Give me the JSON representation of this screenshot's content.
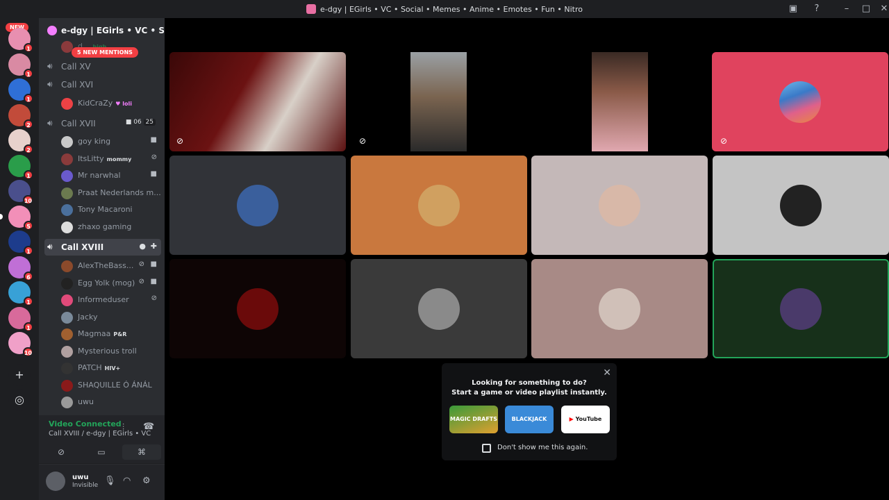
{
  "window": {
    "title": "e-dgy | EGirls • VC • Social • Memes • Anime • Emotes • Fun • Nitro",
    "controls": [
      "inbox-icon",
      "help-icon",
      "minimize-icon",
      "maximize-icon",
      "close-icon"
    ]
  },
  "server_rail": {
    "new_label": "NEW",
    "servers": [
      {
        "badge": "1",
        "color": "#e88fb0"
      },
      {
        "badge": "1",
        "color": "#d98aa3"
      },
      {
        "badge": "1",
        "color": "#2f6fd6"
      },
      {
        "badge": "2",
        "color": "#c24b3a"
      },
      {
        "badge": "2",
        "color": "#e7d1cc"
      },
      {
        "badge": "1",
        "color": "#2a9d4a"
      },
      {
        "badge": "10",
        "color": "#4a4f8c"
      },
      {
        "badge": "5",
        "color": "#f28fb8"
      },
      {
        "badge": "1",
        "color": "#1d3c8c"
      },
      {
        "badge": "6",
        "color": "#c06fd6"
      },
      {
        "badge": "1",
        "color": "#38a1d6"
      },
      {
        "badge": "1",
        "color": "#d86a9b"
      },
      {
        "badge": "10",
        "color": "#f0a0c8"
      }
    ],
    "add_icon": "plus-icon",
    "explore_icon": "compass-icon"
  },
  "guild": {
    "name": "e-dgy | EGirls • VC • S...",
    "mentions": "5 NEW MENTIONS",
    "partial_user_tag": "high"
  },
  "channels": {
    "call_xv": "Call XV",
    "call_xvi": "Call XVI",
    "call_xvi_users": [
      {
        "name": "KidCraZy",
        "tag": "loli",
        "avatar": "#ed4245"
      }
    ],
    "call_xvii": "Call XVII",
    "call_xvii_video": "06",
    "call_xvii_count": "25",
    "call_xvii_users": [
      {
        "name": "goy king",
        "tag": "",
        "avatar": "#c9c9c9",
        "status": "video-icon"
      },
      {
        "name": "ItsLitty",
        "tag": "mommy",
        "avatar": "#8a3b3b",
        "status": "mic-muted-icon"
      },
      {
        "name": "Mr narwhal",
        "tag": "",
        "avatar": "#6a5acd",
        "status": "video-icon"
      },
      {
        "name": "Praat Nederlands m...",
        "tag": "",
        "avatar": "#6b7a4f",
        "status": ""
      },
      {
        "name": "Tony Macaroni",
        "tag": "",
        "avatar": "#4a6f9c",
        "status": ""
      },
      {
        "name": "zhaxo gaming",
        "tag": "",
        "avatar": "#dddddd",
        "status": ""
      }
    ],
    "call_xviii": "Call XVIII",
    "call_xviii_users": [
      {
        "name": "AlexTheBass...",
        "tag": "",
        "avatar": "#8b4a2b",
        "status": "mic-muted-icon video-icon"
      },
      {
        "name": "Egg Yolk (mog)",
        "tag": "",
        "avatar": "#222222",
        "status": "mic-muted-icon video-icon"
      },
      {
        "name": "Informeduser",
        "tag": "",
        "avatar": "#e04a7a",
        "status": "mic-muted-icon"
      },
      {
        "name": "Jacky",
        "tag": "",
        "avatar": "#7a8a9a",
        "status": ""
      },
      {
        "name": "Magmaa",
        "tag": "P&R",
        "avatar": "#a06030",
        "status": ""
      },
      {
        "name": "Mysterious troll",
        "tag": "",
        "avatar": "#b0a0a0",
        "status": ""
      },
      {
        "name": "PATCH",
        "tag": "HIV+",
        "avatar": "#333333",
        "status": ""
      },
      {
        "name": "SHAQUILLE Ó ÁNÁL",
        "tag": "",
        "avatar": "#8a1a1a",
        "status": ""
      },
      {
        "name": "uwu",
        "tag": "",
        "avatar": "#9a9a9a",
        "status": ""
      }
    ]
  },
  "voice_panel": {
    "status": "Video Connected",
    "location": "Call XVIII / e-dgy | EGirls • VC • ..."
  },
  "user_panel": {
    "name": "uwu",
    "status": "Invisible"
  },
  "stage": {
    "tiles_row2": [
      {
        "bg": "#313338",
        "avatar": "#3a5f9c"
      },
      {
        "bg": "#c9783e",
        "avatar": "#d0a060"
      },
      {
        "bg": "#c4b8b8",
        "avatar": "#d8b8a8"
      },
      {
        "bg": "#c4c4c4",
        "avatar": "#222222"
      }
    ],
    "tiles_row3": [
      {
        "bg": "#0e0505",
        "avatar": "#6a0a0a"
      },
      {
        "bg": "#3a3a3a",
        "avatar": "#8a8a8a"
      },
      {
        "bg": "#a88a86",
        "avatar": "#d0c0b8"
      },
      {
        "bg": "#17301a",
        "avatar": "#4a3a6a"
      }
    ],
    "pink_tile_color": "#e0435e"
  },
  "activity_prompt": {
    "line1": "Looking for something to do?",
    "line2": "Start a game or video playlist instantly.",
    "cards": [
      "MAGIC DRAFTS",
      "BLACKJACK",
      "YouTube"
    ],
    "dont_show": "Don't show me this again."
  }
}
